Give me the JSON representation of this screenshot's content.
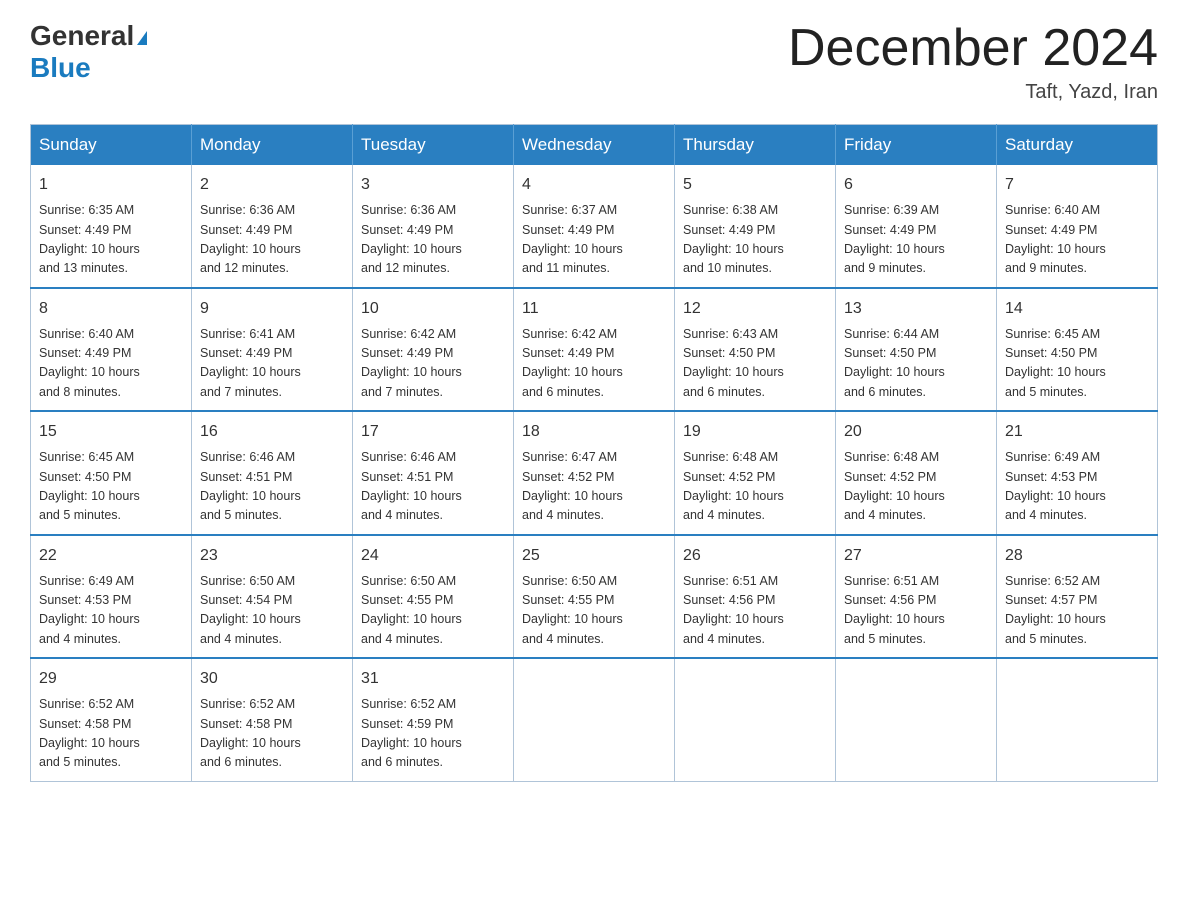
{
  "header": {
    "logo_general": "General",
    "logo_blue": "Blue",
    "month_title": "December 2024",
    "location": "Taft, Yazd, Iran"
  },
  "weekdays": [
    "Sunday",
    "Monday",
    "Tuesday",
    "Wednesday",
    "Thursday",
    "Friday",
    "Saturday"
  ],
  "weeks": [
    [
      {
        "day": "1",
        "sunrise": "6:35 AM",
        "sunset": "4:49 PM",
        "daylight": "10 hours and 13 minutes."
      },
      {
        "day": "2",
        "sunrise": "6:36 AM",
        "sunset": "4:49 PM",
        "daylight": "10 hours and 12 minutes."
      },
      {
        "day": "3",
        "sunrise": "6:36 AM",
        "sunset": "4:49 PM",
        "daylight": "10 hours and 12 minutes."
      },
      {
        "day": "4",
        "sunrise": "6:37 AM",
        "sunset": "4:49 PM",
        "daylight": "10 hours and 11 minutes."
      },
      {
        "day": "5",
        "sunrise": "6:38 AM",
        "sunset": "4:49 PM",
        "daylight": "10 hours and 10 minutes."
      },
      {
        "day": "6",
        "sunrise": "6:39 AM",
        "sunset": "4:49 PM",
        "daylight": "10 hours and 9 minutes."
      },
      {
        "day": "7",
        "sunrise": "6:40 AM",
        "sunset": "4:49 PM",
        "daylight": "10 hours and 9 minutes."
      }
    ],
    [
      {
        "day": "8",
        "sunrise": "6:40 AM",
        "sunset": "4:49 PM",
        "daylight": "10 hours and 8 minutes."
      },
      {
        "day": "9",
        "sunrise": "6:41 AM",
        "sunset": "4:49 PM",
        "daylight": "10 hours and 7 minutes."
      },
      {
        "day": "10",
        "sunrise": "6:42 AM",
        "sunset": "4:49 PM",
        "daylight": "10 hours and 7 minutes."
      },
      {
        "day": "11",
        "sunrise": "6:42 AM",
        "sunset": "4:49 PM",
        "daylight": "10 hours and 6 minutes."
      },
      {
        "day": "12",
        "sunrise": "6:43 AM",
        "sunset": "4:50 PM",
        "daylight": "10 hours and 6 minutes."
      },
      {
        "day": "13",
        "sunrise": "6:44 AM",
        "sunset": "4:50 PM",
        "daylight": "10 hours and 6 minutes."
      },
      {
        "day": "14",
        "sunrise": "6:45 AM",
        "sunset": "4:50 PM",
        "daylight": "10 hours and 5 minutes."
      }
    ],
    [
      {
        "day": "15",
        "sunrise": "6:45 AM",
        "sunset": "4:50 PM",
        "daylight": "10 hours and 5 minutes."
      },
      {
        "day": "16",
        "sunrise": "6:46 AM",
        "sunset": "4:51 PM",
        "daylight": "10 hours and 5 minutes."
      },
      {
        "day": "17",
        "sunrise": "6:46 AM",
        "sunset": "4:51 PM",
        "daylight": "10 hours and 4 minutes."
      },
      {
        "day": "18",
        "sunrise": "6:47 AM",
        "sunset": "4:52 PM",
        "daylight": "10 hours and 4 minutes."
      },
      {
        "day": "19",
        "sunrise": "6:48 AM",
        "sunset": "4:52 PM",
        "daylight": "10 hours and 4 minutes."
      },
      {
        "day": "20",
        "sunrise": "6:48 AM",
        "sunset": "4:52 PM",
        "daylight": "10 hours and 4 minutes."
      },
      {
        "day": "21",
        "sunrise": "6:49 AM",
        "sunset": "4:53 PM",
        "daylight": "10 hours and 4 minutes."
      }
    ],
    [
      {
        "day": "22",
        "sunrise": "6:49 AM",
        "sunset": "4:53 PM",
        "daylight": "10 hours and 4 minutes."
      },
      {
        "day": "23",
        "sunrise": "6:50 AM",
        "sunset": "4:54 PM",
        "daylight": "10 hours and 4 minutes."
      },
      {
        "day": "24",
        "sunrise": "6:50 AM",
        "sunset": "4:55 PM",
        "daylight": "10 hours and 4 minutes."
      },
      {
        "day": "25",
        "sunrise": "6:50 AM",
        "sunset": "4:55 PM",
        "daylight": "10 hours and 4 minutes."
      },
      {
        "day": "26",
        "sunrise": "6:51 AM",
        "sunset": "4:56 PM",
        "daylight": "10 hours and 4 minutes."
      },
      {
        "day": "27",
        "sunrise": "6:51 AM",
        "sunset": "4:56 PM",
        "daylight": "10 hours and 5 minutes."
      },
      {
        "day": "28",
        "sunrise": "6:52 AM",
        "sunset": "4:57 PM",
        "daylight": "10 hours and 5 minutes."
      }
    ],
    [
      {
        "day": "29",
        "sunrise": "6:52 AM",
        "sunset": "4:58 PM",
        "daylight": "10 hours and 5 minutes."
      },
      {
        "day": "30",
        "sunrise": "6:52 AM",
        "sunset": "4:58 PM",
        "daylight": "10 hours and 6 minutes."
      },
      {
        "day": "31",
        "sunrise": "6:52 AM",
        "sunset": "4:59 PM",
        "daylight": "10 hours and 6 minutes."
      },
      null,
      null,
      null,
      null
    ]
  ]
}
